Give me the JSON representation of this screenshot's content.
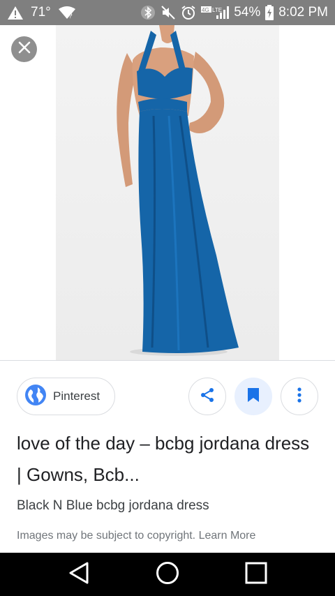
{
  "status_bar": {
    "temperature": "71°",
    "battery": "54%",
    "time": "8:02 PM",
    "network": "4G LTE"
  },
  "viewer": {
    "close_icon": "close-icon",
    "image_alt": "Blue halter cut-out maxi gown on model",
    "dress_color": "#1565a8"
  },
  "source": {
    "name": "Pinterest",
    "icon": "globe-icon",
    "icon_color": "#4285f4"
  },
  "actions": {
    "share_icon": "share-icon",
    "save_icon": "bookmark-icon",
    "more_icon": "more-vert-icon",
    "accent": "#1a73e8"
  },
  "result": {
    "title": "love of the day – bcbg jordana dress | Gowns, Bcb...",
    "subtitle": "Black N Blue bcbg jordana dress",
    "copyright_text": "Images may be subject to copyright.",
    "learn_more": "Learn More"
  },
  "nav": {
    "back_icon": "back-icon",
    "home_icon": "home-icon",
    "recents_icon": "recents-icon"
  }
}
